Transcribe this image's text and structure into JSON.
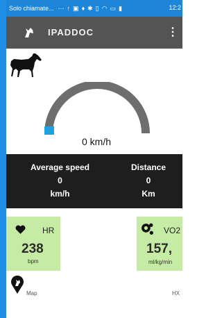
{
  "statusbar": {
    "carrier": "Solo chiamate...",
    "icons": [
      "more-icon",
      "upload-icon",
      "image-icon",
      "location-icon",
      "bluetooth-icon",
      "vibrate-icon",
      "wifi-icon",
      "cast-icon",
      "battery-icon"
    ],
    "time": "12:2"
  },
  "toolbar": {
    "title": "IPADDOC",
    "menu_icon": "more-vert-icon"
  },
  "speed": {
    "value_text": "0 km/h",
    "gauge_fraction": 0.0
  },
  "stats": {
    "average_speed": {
      "label": "Average speed",
      "value": "0",
      "unit": "km/h"
    },
    "distance": {
      "label": "Distance",
      "value": "0",
      "unit": "Km"
    }
  },
  "cards": {
    "hr": {
      "icon": "heart-icon",
      "name": "HR",
      "value": "238",
      "unit": "bpm"
    },
    "vo2": {
      "icon": "oxygen-icon",
      "name": "VO2",
      "value": "157,",
      "unit": "ml/kg/min"
    }
  },
  "bottom": {
    "map_label": "Map",
    "hx_label": "HX"
  },
  "colors": {
    "statusbar": "#1e86d8",
    "toolbar": "#545454",
    "gauge_track": "#6e6e6e",
    "gauge_fill": "#1ea2e2",
    "stats_bg": "#1e1e1e",
    "card_bg": "#c6eba4"
  }
}
